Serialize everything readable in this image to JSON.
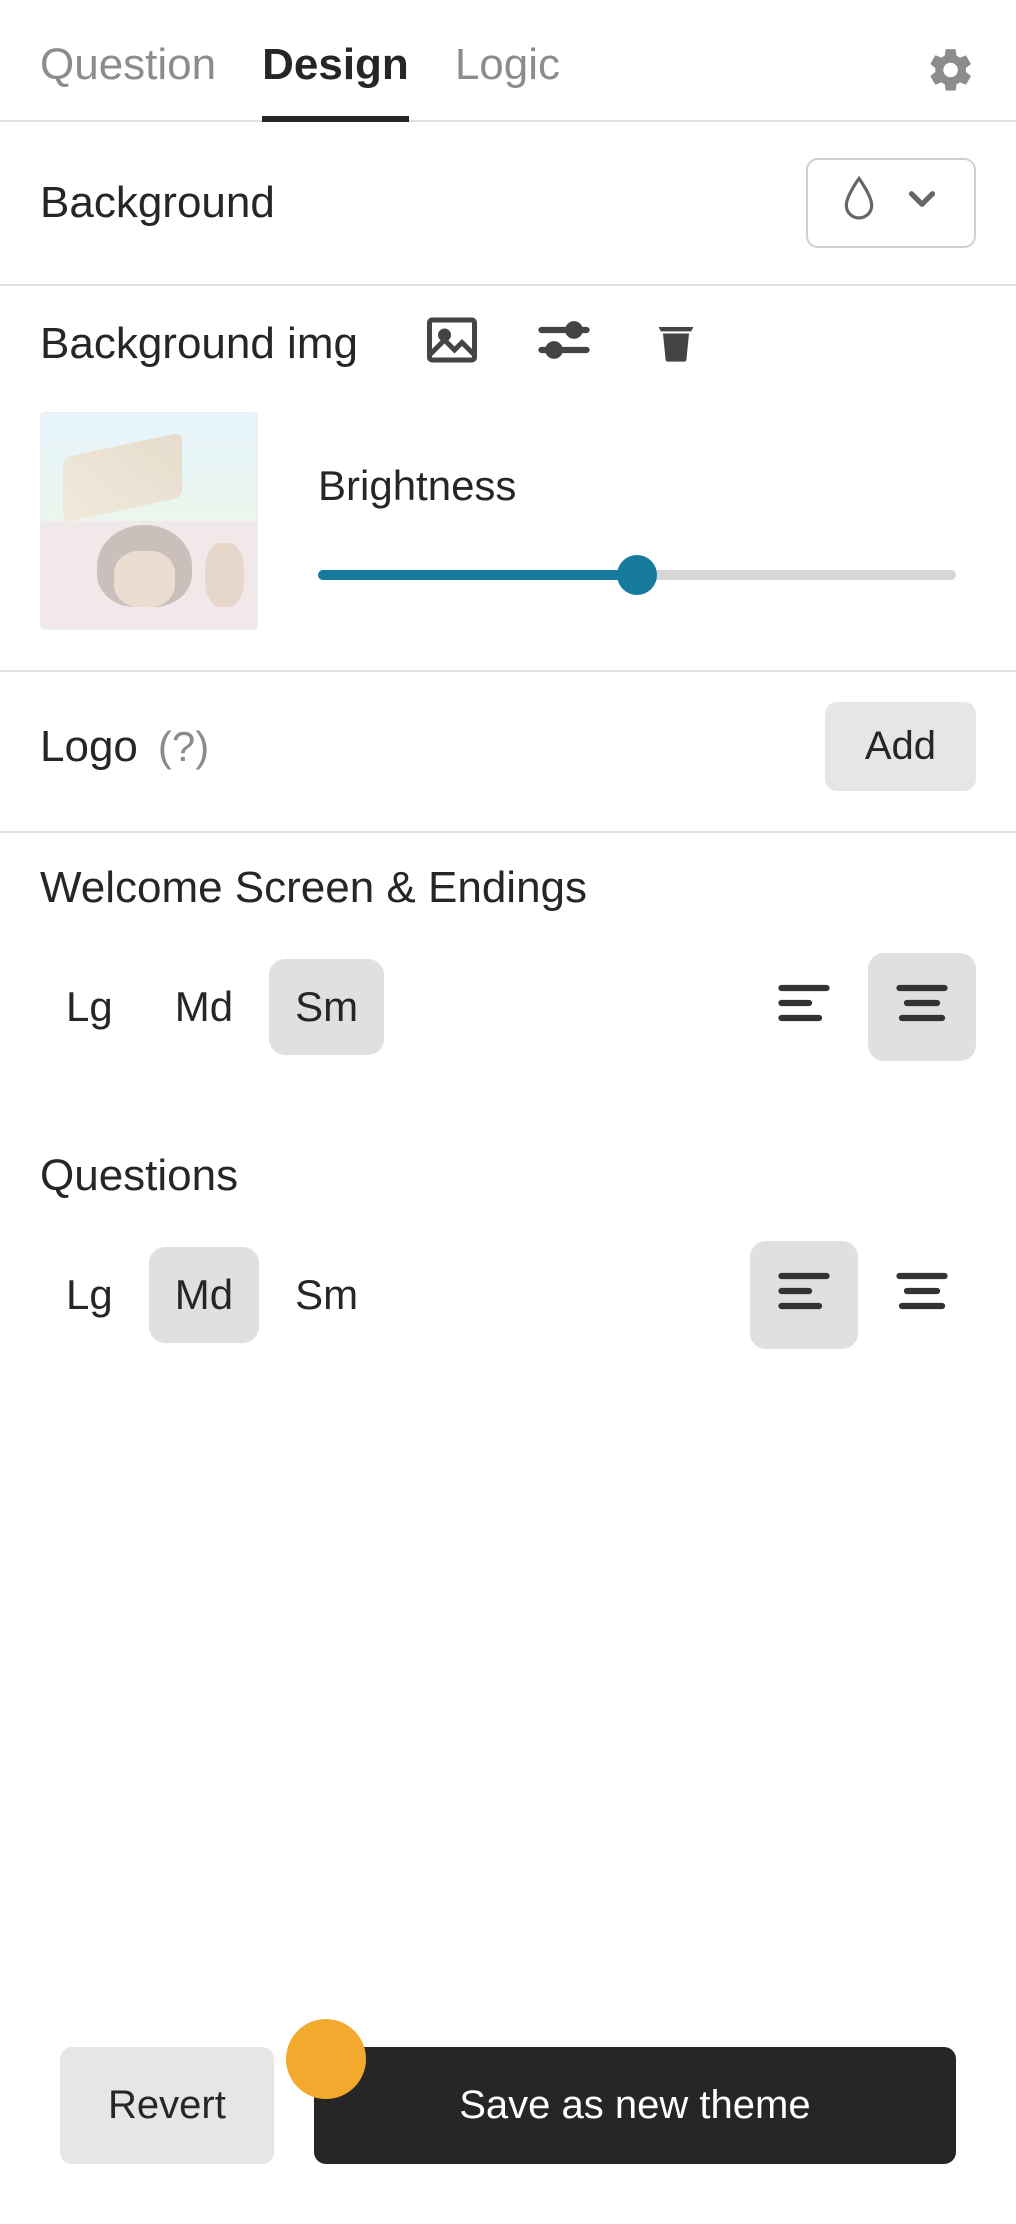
{
  "tabs": {
    "question": "Question",
    "design": "Design",
    "logic": "Logic",
    "active": "design"
  },
  "background": {
    "label": "Background"
  },
  "backgroundImg": {
    "label": "Background img",
    "brightnessLabel": "Brightness",
    "brightnessPercent": 50
  },
  "logo": {
    "label": "Logo",
    "help": "(?)",
    "addLabel": "Add"
  },
  "welcome": {
    "heading": "Welcome Screen & Endings",
    "sizes": {
      "lg": "Lg",
      "md": "Md",
      "sm": "Sm"
    },
    "selectedSize": "sm",
    "selectedAlign": "center"
  },
  "questions": {
    "heading": "Questions",
    "sizes": {
      "lg": "Lg",
      "md": "Md",
      "sm": "Sm"
    },
    "selectedSize": "md",
    "selectedAlign": "left"
  },
  "footer": {
    "revert": "Revert",
    "save": "Save as new theme"
  }
}
